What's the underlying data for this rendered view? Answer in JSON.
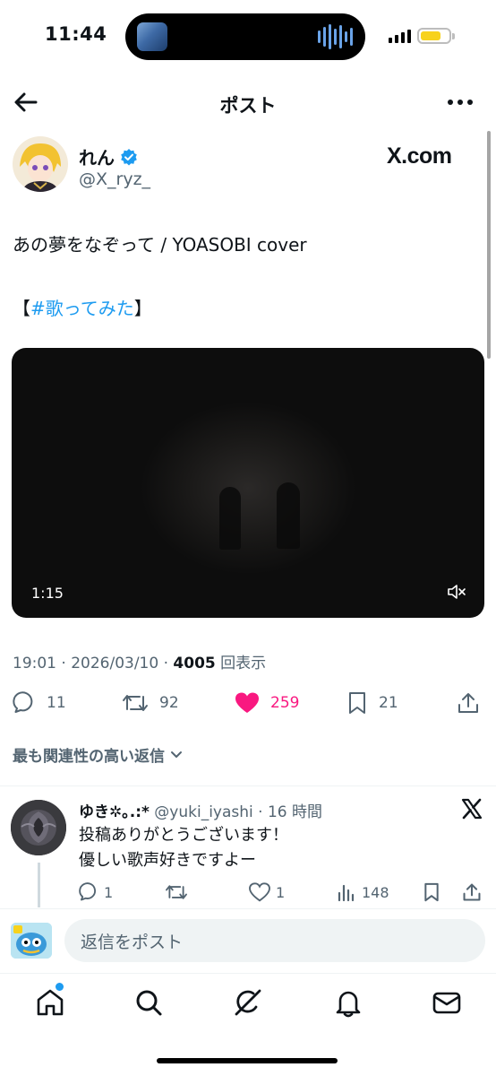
{
  "status_bar": {
    "time": "11:44"
  },
  "header": {
    "title": "ポスト"
  },
  "post": {
    "author_name": "れん",
    "author_handle": "@X_ryz_",
    "brand": "X.com",
    "text": "あの夢をなぞって / YOASOBI cover",
    "tag_open": "【",
    "hashtag": "#歌ってみた",
    "tag_close": "】",
    "video_time": "1:15",
    "timestamp": "19:01 · 2026/03/10 · ",
    "views_count": "4005",
    "views_label": "回表示"
  },
  "actions": {
    "replies": "11",
    "reposts": "92",
    "likes": "259",
    "bookmarks": "21"
  },
  "replies_sort": "最も関連性の高い返信",
  "reply": {
    "name": "ゆき✲｡.:*",
    "handle": " @yuki_iyashi · 16 時間",
    "line1": "投稿ありがとうございます！",
    "line2": "優しい歌声好きですよー",
    "replies": "1",
    "likes": "1",
    "views": "148"
  },
  "composer": {
    "placeholder": "返信をポスト"
  },
  "colors": {
    "accent": "#1d9bf0",
    "like": "#f91880",
    "secondary_text": "#536471"
  },
  "tabs": [
    "home-icon",
    "search-icon",
    "grok-icon",
    "notifications-icon",
    "messages-icon"
  ]
}
